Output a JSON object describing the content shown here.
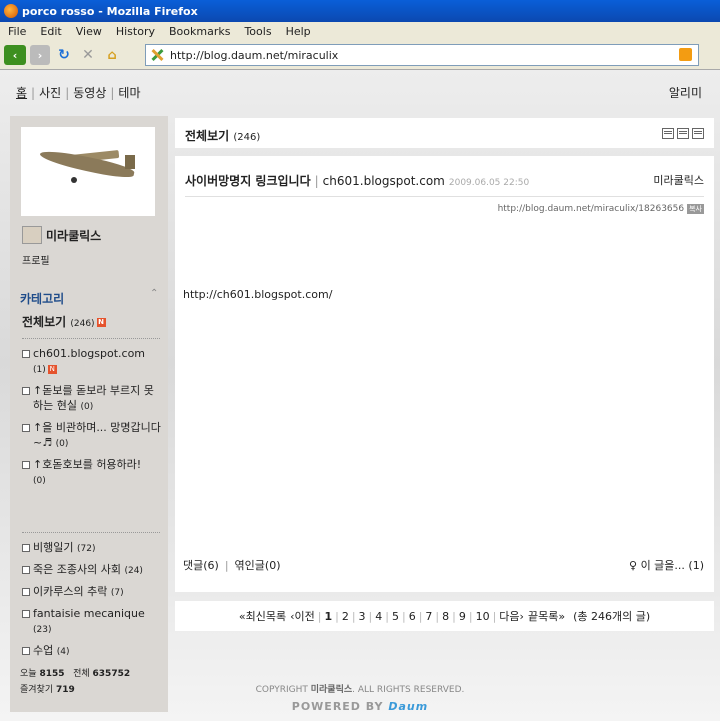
{
  "window": {
    "title": "porco rosso - Mozilla Firefox"
  },
  "menu": [
    "File",
    "Edit",
    "View",
    "History",
    "Bookmarks",
    "Tools",
    "Help"
  ],
  "nav": {
    "url": "http://blog.daum.net/miraculix"
  },
  "top": {
    "links": [
      "홈",
      "사진",
      "동영상",
      "테마"
    ],
    "alarm": "알리미"
  },
  "sidebar": {
    "nickname": "미라쿨릭스",
    "profile_label": "프로필",
    "category_title": "카테고리",
    "all_label": "전체보기",
    "all_count": "(246)",
    "new_badge": "N",
    "group1": [
      {
        "label": "ch601.blogspot.com",
        "count": "(1)",
        "new": true
      },
      {
        "label": "↑돋보를 돋보라 부르지 못하는 현실",
        "count": "(0)",
        "new": false
      },
      {
        "label": "↑을 비관하며... 망명갑니다~♬",
        "count": "(0)",
        "new": false
      },
      {
        "label": "↑호돋호보를 허용하라!",
        "count": "(0)",
        "new": false
      }
    ],
    "group2": [
      {
        "label": "비행일기",
        "count": "(72)"
      },
      {
        "label": "죽은 조종사의 사회",
        "count": "(24)"
      },
      {
        "label": "이카루스의 추락",
        "count": "(7)"
      },
      {
        "label": "fantaisie mecanique",
        "count": "(23)"
      },
      {
        "label": "수업",
        "count": "(4)"
      }
    ],
    "stats": {
      "today_label": "오늘",
      "today": "8155",
      "total_label": "전체",
      "total": "635752",
      "fav_label": "즐겨찾기",
      "fav": "719"
    }
  },
  "header": {
    "title": "전체보기",
    "count": "(246)"
  },
  "post": {
    "title": "사이버망명지 링크입니다",
    "url": "ch601.blogspot.com",
    "date": "2009.06.05 22:50",
    "author": "미라쿨릭스",
    "permalink": "http://blog.daum.net/miraculix/18263656",
    "copy_label": "복사",
    "content": "http://ch601.blogspot.com/",
    "comments": "댓글(6)",
    "trackbacks": "엮인글(0)",
    "recommend": "이 글을... (1)"
  },
  "pager": {
    "latest": "최신목록",
    "prev": "이전",
    "pages": [
      "1",
      "2",
      "3",
      "4",
      "5",
      "6",
      "7",
      "8",
      "9",
      "10"
    ],
    "next": "다음",
    "last": "끝목록",
    "total": "(총 246개의 글)"
  },
  "footer": {
    "copyright_pre": "COPYRIGHT",
    "owner": "미라쿨릭스",
    "copyright_post": ". ALL RIGHTS RESERVED.",
    "powered": "POWERED BY",
    "brand": "Daum"
  }
}
